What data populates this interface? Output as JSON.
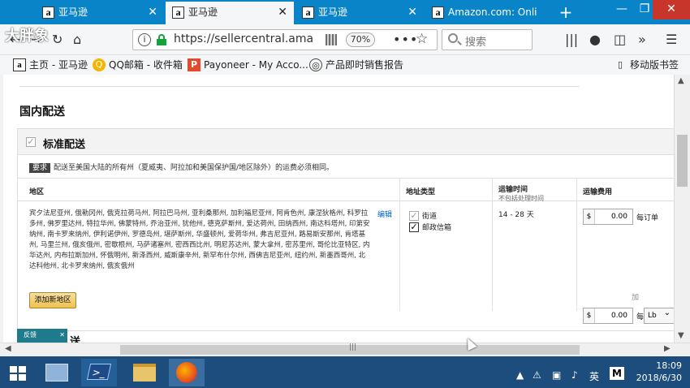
{
  "tabs": [
    {
      "favicon": "a",
      "label": "亚马逊",
      "active": false
    },
    {
      "favicon": "a",
      "label": "亚马逊",
      "active": true
    },
    {
      "favicon": "a",
      "label": "亚马逊",
      "active": false
    },
    {
      "favicon": "a",
      "label": "Amazon.com: Onli",
      "active": false
    }
  ],
  "newtab_symbol": "+",
  "window_controls": {
    "minimize": "—",
    "restore": "❐",
    "close": "✕"
  },
  "watermark": "大胖象",
  "nav": {
    "url": "https://sellercentral.ama",
    "zoom": "70%",
    "search_placeholder": "搜索",
    "more": "•••",
    "star": "☆"
  },
  "bookmarks": [
    {
      "icon": "amazon-icon",
      "label": "主页 - 亚马逊"
    },
    {
      "icon": "qq-icon",
      "label": "QQ邮箱 - 收件箱"
    },
    {
      "icon": "payoneer-icon",
      "label": "Payoneer - My Acco..."
    },
    {
      "icon": "globe-icon",
      "label": "产品即时销售报告"
    }
  ],
  "mobile_bookmarks": "移动版书签",
  "page": {
    "section_title": "国内配送",
    "card_title": "标准配送",
    "req_badge": "要求",
    "req_text": "配送至美国大陆的所有州（夏威夷、阿拉加和美国保护国/地区除外）的运费必须相同。",
    "columns": {
      "region": "地区",
      "address_type": "地址类型",
      "transit": "运输时间",
      "transit_sub": "不包括处理时间",
      "fee": "运输费用"
    },
    "region_text": "宾夕法尼亚州, 俄勒冈州, 俄克拉荷马州, 阿拉巴马州, 亚利桑那州, 加利福尼亚州, 阿肯色州, 康涅狄格州, 科罗拉多州, 佛罗里达州, 特拉华州, 佛蒙特州, 乔治亚州, 犹他州, 德克萨斯州, 爱达荷州, 田纳西州, 南达科塔州, 印第安纳州, 南卡罗来纳州, 伊利诺伊州, 罗德岛州, 堪萨斯州, 华盛顿州, 爱荷华州, 弗吉尼亚州, 路易斯安那州, 肯塔基州, 马里兰州, 俄亥俄州, 密歇根州, 马萨诸塞州, 密西西比州, 明尼苏达州, 蒙大拿州, 密苏里州, 哥伦比亚特区, 内华达州, 内布拉斯加州, 怀俄明州, 新泽西州, 威斯康辛州, 新罕布什尔州, 西佛吉尼亚州, 纽约州, 新墨西哥州, 北达科他州, 北卡罗来纳州, 俄亥俄州",
    "edit": "编辑",
    "address_types": [
      {
        "label": "街道",
        "checked": false
      },
      {
        "label": "邮政信箱",
        "checked": true
      }
    ],
    "transit_time": "14 - 28 天",
    "fee_per_order": {
      "currency": "$",
      "value": "0.00",
      "label": "每订单"
    },
    "plus": "加",
    "fee_per_unit": {
      "currency": "$",
      "value": "0.00",
      "label": "每",
      "unit": "Lb"
    },
    "add_region": "添加新地区",
    "feedback": "反馈",
    "feedback_close": "✕",
    "partial_heading": "送"
  },
  "taskbar": {
    "ime": "英",
    "ime_m": "M",
    "time": "18:09",
    "date": "2018/6/30"
  }
}
